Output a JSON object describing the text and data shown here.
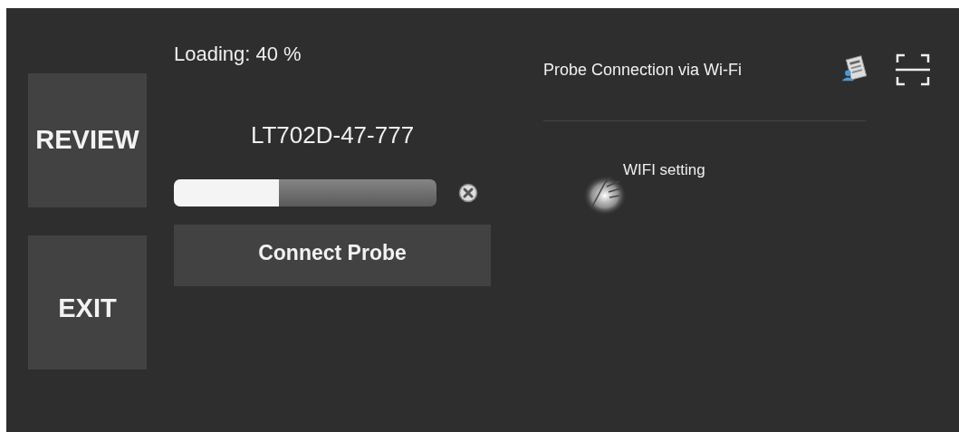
{
  "sidebar": {
    "buttons": [
      {
        "label": "REVIEW"
      },
      {
        "label": "EXIT"
      }
    ]
  },
  "loading": {
    "label": "Loading: 40 %",
    "device": "LT702D-47-777",
    "level": 0.4
  },
  "connect_button": {
    "label": "Connect Probe"
  },
  "wifi_panel": {
    "title": "Probe Connection via Wi-Fi",
    "link": "WIFI setting"
  }
}
